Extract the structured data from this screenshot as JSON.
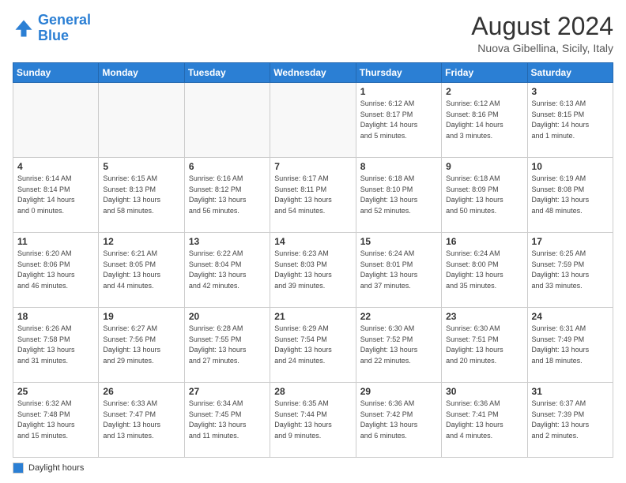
{
  "header": {
    "logo_line1": "General",
    "logo_line2": "Blue",
    "month_year": "August 2024",
    "location": "Nuova Gibellina, Sicily, Italy"
  },
  "days_of_week": [
    "Sunday",
    "Monday",
    "Tuesday",
    "Wednesday",
    "Thursday",
    "Friday",
    "Saturday"
  ],
  "footer": {
    "legend_label": "Daylight hours"
  },
  "weeks": [
    [
      {
        "day": "",
        "info": ""
      },
      {
        "day": "",
        "info": ""
      },
      {
        "day": "",
        "info": ""
      },
      {
        "day": "",
        "info": ""
      },
      {
        "day": "1",
        "info": "Sunrise: 6:12 AM\nSunset: 8:17 PM\nDaylight: 14 hours\nand 5 minutes."
      },
      {
        "day": "2",
        "info": "Sunrise: 6:12 AM\nSunset: 8:16 PM\nDaylight: 14 hours\nand 3 minutes."
      },
      {
        "day": "3",
        "info": "Sunrise: 6:13 AM\nSunset: 8:15 PM\nDaylight: 14 hours\nand 1 minute."
      }
    ],
    [
      {
        "day": "4",
        "info": "Sunrise: 6:14 AM\nSunset: 8:14 PM\nDaylight: 14 hours\nand 0 minutes."
      },
      {
        "day": "5",
        "info": "Sunrise: 6:15 AM\nSunset: 8:13 PM\nDaylight: 13 hours\nand 58 minutes."
      },
      {
        "day": "6",
        "info": "Sunrise: 6:16 AM\nSunset: 8:12 PM\nDaylight: 13 hours\nand 56 minutes."
      },
      {
        "day": "7",
        "info": "Sunrise: 6:17 AM\nSunset: 8:11 PM\nDaylight: 13 hours\nand 54 minutes."
      },
      {
        "day": "8",
        "info": "Sunrise: 6:18 AM\nSunset: 8:10 PM\nDaylight: 13 hours\nand 52 minutes."
      },
      {
        "day": "9",
        "info": "Sunrise: 6:18 AM\nSunset: 8:09 PM\nDaylight: 13 hours\nand 50 minutes."
      },
      {
        "day": "10",
        "info": "Sunrise: 6:19 AM\nSunset: 8:08 PM\nDaylight: 13 hours\nand 48 minutes."
      }
    ],
    [
      {
        "day": "11",
        "info": "Sunrise: 6:20 AM\nSunset: 8:06 PM\nDaylight: 13 hours\nand 46 minutes."
      },
      {
        "day": "12",
        "info": "Sunrise: 6:21 AM\nSunset: 8:05 PM\nDaylight: 13 hours\nand 44 minutes."
      },
      {
        "day": "13",
        "info": "Sunrise: 6:22 AM\nSunset: 8:04 PM\nDaylight: 13 hours\nand 42 minutes."
      },
      {
        "day": "14",
        "info": "Sunrise: 6:23 AM\nSunset: 8:03 PM\nDaylight: 13 hours\nand 39 minutes."
      },
      {
        "day": "15",
        "info": "Sunrise: 6:24 AM\nSunset: 8:01 PM\nDaylight: 13 hours\nand 37 minutes."
      },
      {
        "day": "16",
        "info": "Sunrise: 6:24 AM\nSunset: 8:00 PM\nDaylight: 13 hours\nand 35 minutes."
      },
      {
        "day": "17",
        "info": "Sunrise: 6:25 AM\nSunset: 7:59 PM\nDaylight: 13 hours\nand 33 minutes."
      }
    ],
    [
      {
        "day": "18",
        "info": "Sunrise: 6:26 AM\nSunset: 7:58 PM\nDaylight: 13 hours\nand 31 minutes."
      },
      {
        "day": "19",
        "info": "Sunrise: 6:27 AM\nSunset: 7:56 PM\nDaylight: 13 hours\nand 29 minutes."
      },
      {
        "day": "20",
        "info": "Sunrise: 6:28 AM\nSunset: 7:55 PM\nDaylight: 13 hours\nand 27 minutes."
      },
      {
        "day": "21",
        "info": "Sunrise: 6:29 AM\nSunset: 7:54 PM\nDaylight: 13 hours\nand 24 minutes."
      },
      {
        "day": "22",
        "info": "Sunrise: 6:30 AM\nSunset: 7:52 PM\nDaylight: 13 hours\nand 22 minutes."
      },
      {
        "day": "23",
        "info": "Sunrise: 6:30 AM\nSunset: 7:51 PM\nDaylight: 13 hours\nand 20 minutes."
      },
      {
        "day": "24",
        "info": "Sunrise: 6:31 AM\nSunset: 7:49 PM\nDaylight: 13 hours\nand 18 minutes."
      }
    ],
    [
      {
        "day": "25",
        "info": "Sunrise: 6:32 AM\nSunset: 7:48 PM\nDaylight: 13 hours\nand 15 minutes."
      },
      {
        "day": "26",
        "info": "Sunrise: 6:33 AM\nSunset: 7:47 PM\nDaylight: 13 hours\nand 13 minutes."
      },
      {
        "day": "27",
        "info": "Sunrise: 6:34 AM\nSunset: 7:45 PM\nDaylight: 13 hours\nand 11 minutes."
      },
      {
        "day": "28",
        "info": "Sunrise: 6:35 AM\nSunset: 7:44 PM\nDaylight: 13 hours\nand 9 minutes."
      },
      {
        "day": "29",
        "info": "Sunrise: 6:36 AM\nSunset: 7:42 PM\nDaylight: 13 hours\nand 6 minutes."
      },
      {
        "day": "30",
        "info": "Sunrise: 6:36 AM\nSunset: 7:41 PM\nDaylight: 13 hours\nand 4 minutes."
      },
      {
        "day": "31",
        "info": "Sunrise: 6:37 AM\nSunset: 7:39 PM\nDaylight: 13 hours\nand 2 minutes."
      }
    ]
  ]
}
